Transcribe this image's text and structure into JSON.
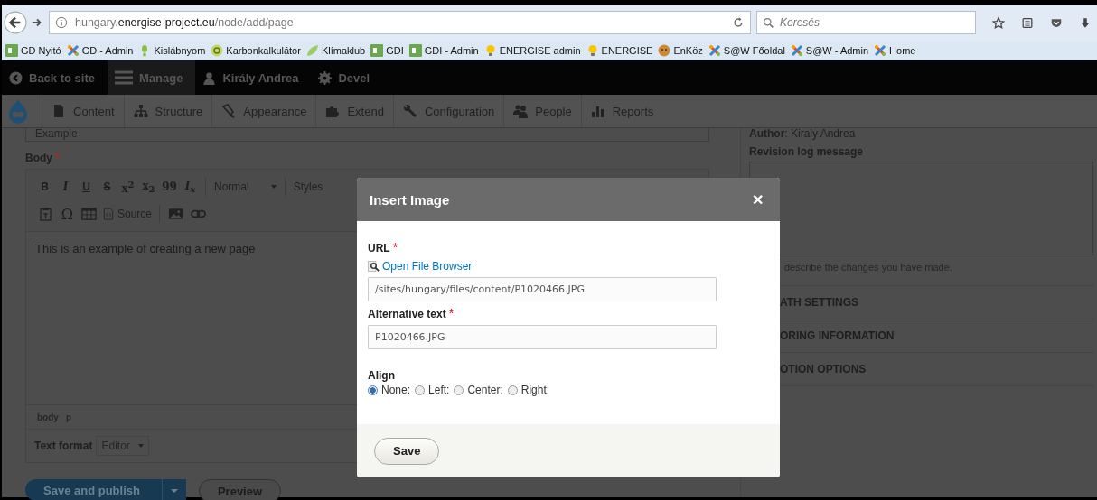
{
  "browser": {
    "url_host": "hungary.",
    "url_domain": "energise-project.eu",
    "url_path": "/node/add/page",
    "search_placeholder": "Keresés"
  },
  "bookmarks": [
    {
      "label": "GD Nyitó",
      "kind": "square"
    },
    {
      "label": "GD - Admin",
      "kind": "cross"
    },
    {
      "label": "Kislábnyom",
      "kind": "footprint"
    },
    {
      "label": "Karbonkalkulátor",
      "kind": "circle"
    },
    {
      "label": "Klímaklub",
      "kind": "leaf"
    },
    {
      "label": "GDI",
      "kind": "square"
    },
    {
      "label": "GDI - Admin",
      "kind": "square"
    },
    {
      "label": "ENERGISE admin",
      "kind": "bulb"
    },
    {
      "label": "ENERGISE",
      "kind": "bulb"
    },
    {
      "label": "EnKöz",
      "kind": "round"
    },
    {
      "label": "S@W Főoldal",
      "kind": "cross"
    },
    {
      "label": "S@W - Admin",
      "kind": "cross"
    },
    {
      "label": "Home",
      "kind": "cross"
    }
  ],
  "admin_bar": [
    {
      "label": "Back to site",
      "kind": "back",
      "selected": false
    },
    {
      "label": "Manage",
      "kind": "menu",
      "selected": true
    },
    {
      "label": "Király Andrea",
      "kind": "user",
      "selected": false
    },
    {
      "label": "Devel",
      "kind": "gear",
      "selected": false
    }
  ],
  "tray": [
    {
      "label": "Content",
      "kind": "content"
    },
    {
      "label": "Structure",
      "kind": "structure"
    },
    {
      "label": "Appearance",
      "kind": "appearance"
    },
    {
      "label": "Extend",
      "kind": "extend"
    },
    {
      "label": "Configuration",
      "kind": "configuration"
    },
    {
      "label": "People",
      "kind": "people"
    },
    {
      "label": "Reports",
      "kind": "reports"
    }
  ],
  "form": {
    "title_value": "Example",
    "body_label": "Body",
    "body_required_mark": "*",
    "toolbar_row_1": [
      {
        "kind": "bold",
        "glyph": "B"
      },
      {
        "kind": "italic",
        "glyph": "I"
      },
      {
        "kind": "underline",
        "glyph": "U"
      },
      {
        "kind": "strike",
        "glyph": "S"
      },
      {
        "kind": "superscript",
        "glyph": "x$^{2}$"
      },
      {
        "kind": "subscript",
        "glyph": "x$_{2}$"
      },
      {
        "kind": "quote",
        "glyph": "99"
      },
      {
        "kind": "clear",
        "glyph": "I$_{x}$"
      }
    ],
    "format_dropdown": "Normal",
    "styles_dropdown": "Styles",
    "toolbar_row_2": [
      {
        "kind": "paste"
      },
      {
        "kind": "symbol",
        "glyph": "Ω"
      },
      {
        "kind": "table"
      },
      {
        "kind": "source",
        "glyph": "Source"
      },
      {
        "kind": "image"
      },
      {
        "kind": "link"
      }
    ],
    "content": "This is an example of creating a new page",
    "path": [
      "body",
      "p"
    ],
    "text_format_label": "Text format",
    "text_format_value": "Editor",
    "primary_button": "Save and publish",
    "secondary_button": "Preview"
  },
  "sidebar": {
    "author_label": "Author",
    "author_value": ": Kiraly Andrea",
    "revision_label": "Revision log message",
    "revision_hint": "describe the changes you have made.",
    "sections": [
      "ATH SETTINGS",
      "ORING INFORMATION",
      "OTION OPTIONS"
    ]
  },
  "dialog": {
    "title": "Insert Image",
    "close_glyph": "✕",
    "url_label": "URL",
    "url_required_mark": "*",
    "file_browser_link": "Open File Browser",
    "url_value": "/sites/hungary/files/content/P1020466.JPG",
    "alt_label": "Alternative text",
    "alt_required_mark": "*",
    "alt_value": "P1020466.JPG",
    "align_label": "Align",
    "align_options": [
      {
        "label": "None:",
        "selected": true
      },
      {
        "label": "Left:",
        "selected": false
      },
      {
        "label": "Center:",
        "selected": false
      },
      {
        "label": "Right:",
        "selected": false
      }
    ],
    "save_label": "Save"
  }
}
